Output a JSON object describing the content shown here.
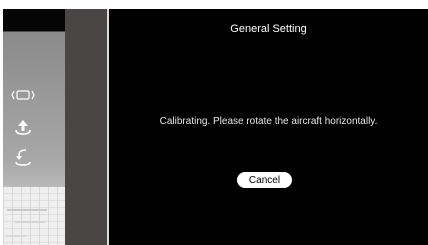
{
  "dialog": {
    "title": "General Setting",
    "message": "Calibrating. Please rotate the aircraft horizontally.",
    "cancel_label": "Cancel"
  },
  "sidebar": {
    "icons": [
      "aircraft-status-icon",
      "takeoff-icon",
      "return-home-icon"
    ]
  },
  "colors": {
    "dialog_background": "#000000",
    "strip": "#4a4646",
    "button_background": "#ffffff"
  }
}
